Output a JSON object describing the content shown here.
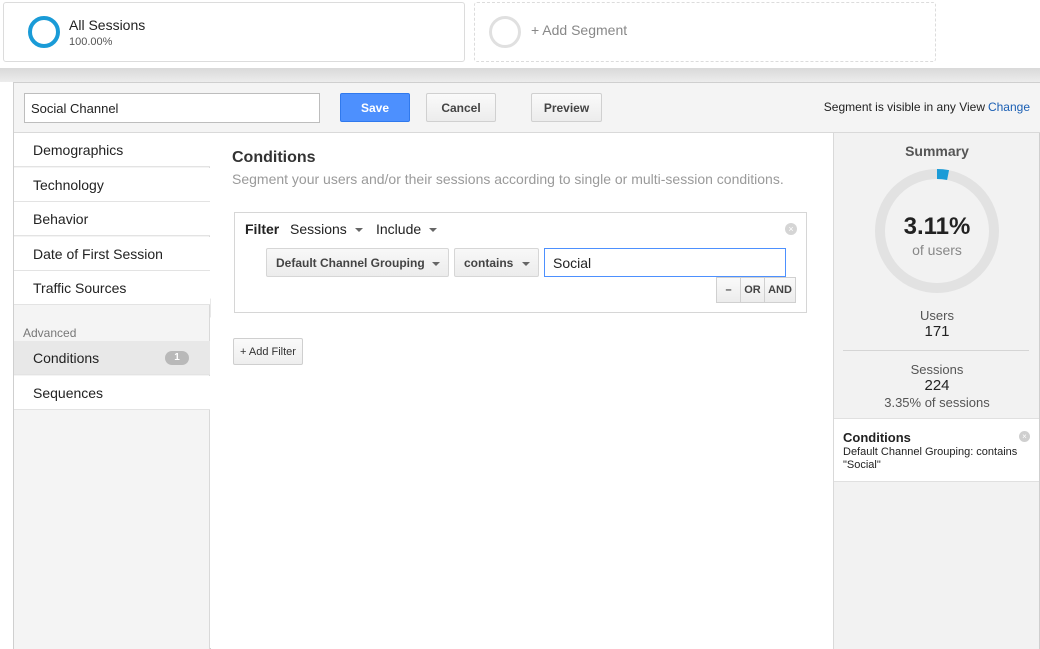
{
  "segments": {
    "active": {
      "title": "All Sessions",
      "percent": "100.00%"
    },
    "add_label": "+ Add Segment"
  },
  "toolbar": {
    "segment_name": "Social Channel",
    "save_label": "Save",
    "cancel_label": "Cancel",
    "preview_label": "Preview",
    "visibility_text": "Segment is visible in any View",
    "change_label": "Change"
  },
  "nav": {
    "items": [
      "Demographics",
      "Technology",
      "Behavior",
      "Date of First Session",
      "Traffic Sources"
    ],
    "advanced_heading": "Advanced",
    "advanced_items": [
      {
        "label": "Conditions",
        "badge": "1"
      },
      {
        "label": "Sequences"
      }
    ]
  },
  "conditions": {
    "title": "Conditions",
    "subtitle": "Segment your users and/or their sessions according to single or multi-session conditions.",
    "filter": {
      "label": "Filter",
      "scope": "Sessions",
      "mode": "Include",
      "dimension": "Default Channel Grouping",
      "operator": "contains",
      "value": "Social",
      "remove_icon": "close-circle-icon"
    },
    "logic_buttons": {
      "minus": "–",
      "or": "OR",
      "and": "AND"
    },
    "add_filter_label": "+ Add Filter"
  },
  "summary": {
    "title": "Summary",
    "percent": "3.11%",
    "percent_fraction": 0.0311,
    "of_label": "of users",
    "users_label": "Users",
    "users_value": "171",
    "sessions_label": "Sessions",
    "sessions_value": "224",
    "sessions_pct": "3.35% of sessions",
    "conditions_card": {
      "title": "Conditions",
      "description": "Default Channel Grouping: contains \"Social\""
    }
  },
  "colors": {
    "accent": "#1a9bd7",
    "save_button": "#4d90fe",
    "link": "#1a5fb4"
  }
}
